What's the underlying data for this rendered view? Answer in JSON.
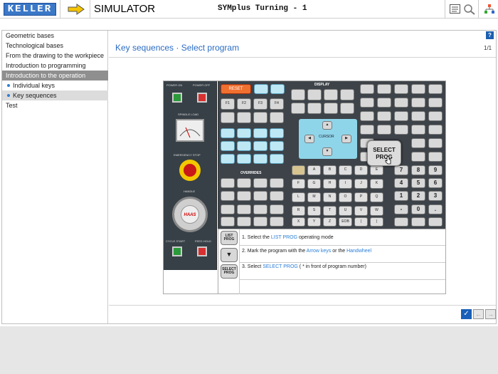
{
  "header": {
    "logo": "KELLER",
    "app_title": "SIMULATOR",
    "program_title": "SYMplus Turning - 1"
  },
  "sidebar": {
    "items": [
      {
        "label": "Geometric bases",
        "state": "normal"
      },
      {
        "label": "Technological bases",
        "state": "normal"
      },
      {
        "label": "From the drawing to the workpiece",
        "state": "normal"
      },
      {
        "label": "Introduction to programming",
        "state": "normal"
      },
      {
        "label": "Introduction to the operation",
        "state": "active"
      },
      {
        "label": "Individual keys",
        "state": "sub"
      },
      {
        "label": "Key sequences",
        "state": "sub-selected"
      },
      {
        "label": "Test",
        "state": "normal"
      }
    ]
  },
  "main": {
    "help": "?",
    "heading": "Key sequences · Select program",
    "pager": "1/1"
  },
  "controller": {
    "power_on": "POWER ON",
    "power_off": "POWER OFF",
    "spindle_load": "SPINDLE LOAD",
    "emergency_stop": "EMERGENCY STOP",
    "handle": "HANDLE",
    "brand": "HAAS",
    "cycle_start": "CYCLE START",
    "feed_hold": "FEED HOLD",
    "reset": "RESET",
    "display": "DISPLAY",
    "overrides": "OVERRIDES",
    "cursor": "CURSOR",
    "callout": "SELECT PROG",
    "alpha_keys": [
      "A",
      "B",
      "C",
      "D",
      "E",
      "F",
      "G",
      "H",
      "I",
      "J",
      "K",
      "L",
      "M",
      "N",
      "O",
      "P",
      "Q",
      "R",
      "S",
      "T",
      "U",
      "V",
      "W",
      "X",
      "Y",
      "Z",
      "EOB",
      "(",
      ")"
    ],
    "num_keys": [
      "7",
      "8",
      "9",
      "4",
      "5",
      "6",
      "1",
      "2",
      "3",
      "-",
      "0",
      "."
    ],
    "f_keys": [
      "F1",
      "F2",
      "F3",
      "F4"
    ]
  },
  "steps": [
    {
      "key": "LIST PROG",
      "pre": "1. Select the ",
      "hl1": "LIST PROG",
      "mid": " operating mode",
      "hl2": "",
      "post": ""
    },
    {
      "key": "▼",
      "pre": "2. Mark the program with the ",
      "hl1": "Arrow keys",
      "mid": " or the ",
      "hl2": "Handwheel",
      "post": ""
    },
    {
      "key": "SELECT PROG",
      "pre": "3. Select ",
      "hl1": "SELECT PROG",
      "mid": " ( * in front of program number)",
      "hl2": "",
      "post": ""
    }
  ],
  "footer_nav": {
    "check": "✓",
    "prev": "←",
    "next": "→"
  },
  "colors": {
    "accent": "#2a6cc4",
    "active_bg": "#8f8f8f",
    "panel_dark": "#3d4349",
    "reset": "#f07030"
  }
}
